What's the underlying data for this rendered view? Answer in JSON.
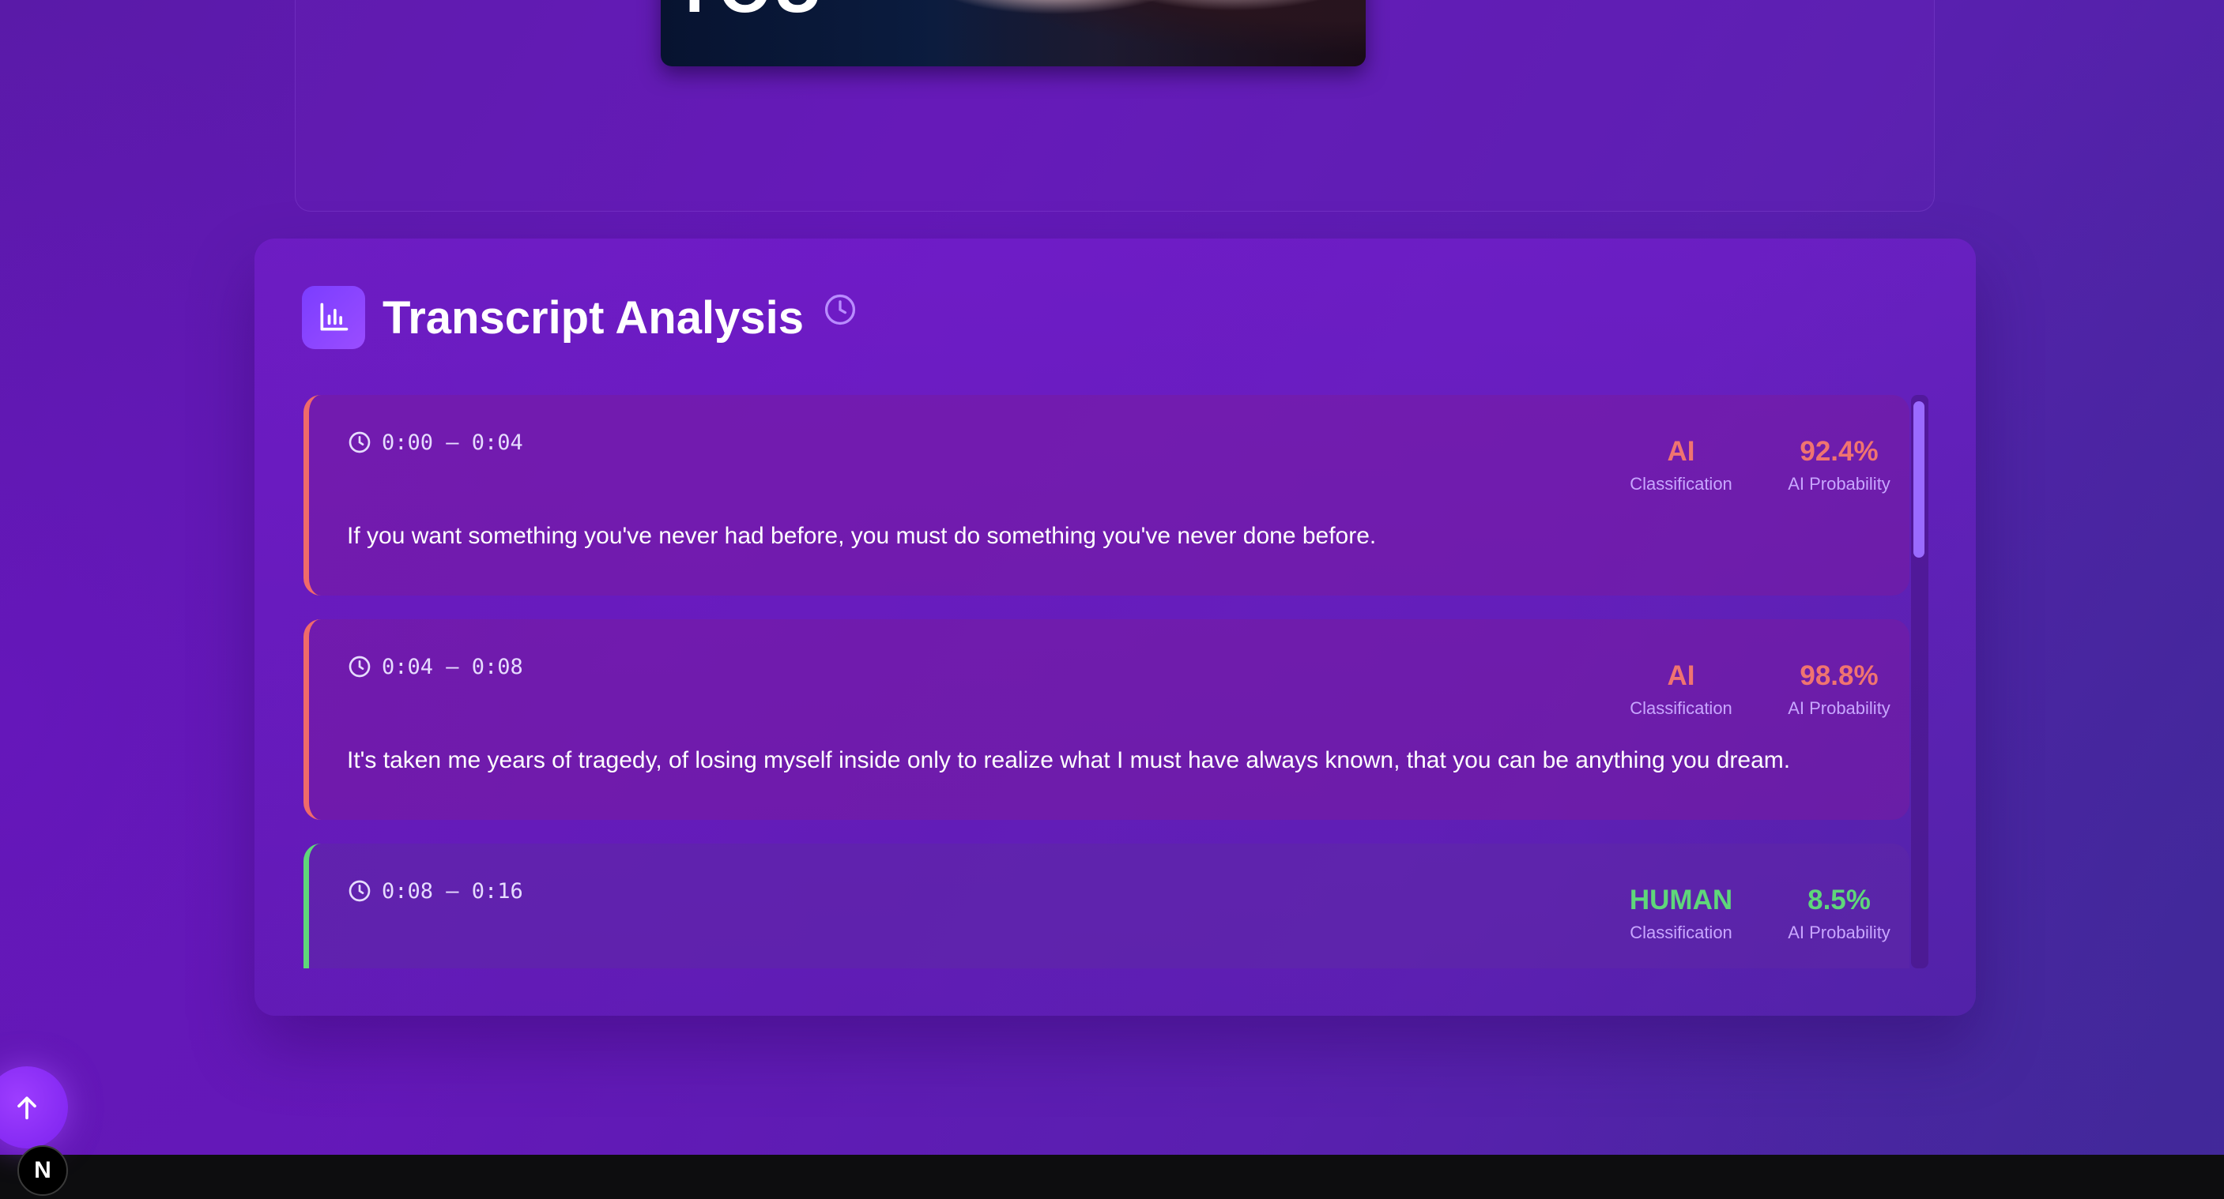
{
  "video": {
    "caption": "YOU"
  },
  "transcript": {
    "title": "Transcript Analysis",
    "icon": "bar-chart-icon",
    "history_icon": "clock-icon",
    "segments": [
      {
        "time": "0:00 – 0:04",
        "classification": "AI",
        "classification_label": "Classification",
        "probability": "92.4%",
        "probability_label": "AI Probability",
        "text": "If you want something you've never had before, you must do something you've never done before.",
        "color": "#f07470"
      },
      {
        "time": "0:04 – 0:08",
        "classification": "AI",
        "classification_label": "Classification",
        "probability": "98.8%",
        "probability_label": "AI Probability",
        "text": "It's taken me years of tragedy, of losing myself inside only to realize what I must have always known, that you can be anything you dream.",
        "color": "#f07470"
      },
      {
        "time": "0:08 – 0:16",
        "classification": "HUMAN",
        "classification_label": "Classification",
        "probability": "8.5%",
        "probability_label": "AI Probability",
        "text": "",
        "color": "#5fd77a"
      }
    ]
  },
  "controls": {
    "scroll_top_icon": "arrow-up-icon",
    "dev_badge": "N"
  },
  "colors": {
    "accent": "#8a3dff",
    "ai": "#f07470",
    "human": "#5fd77a"
  }
}
